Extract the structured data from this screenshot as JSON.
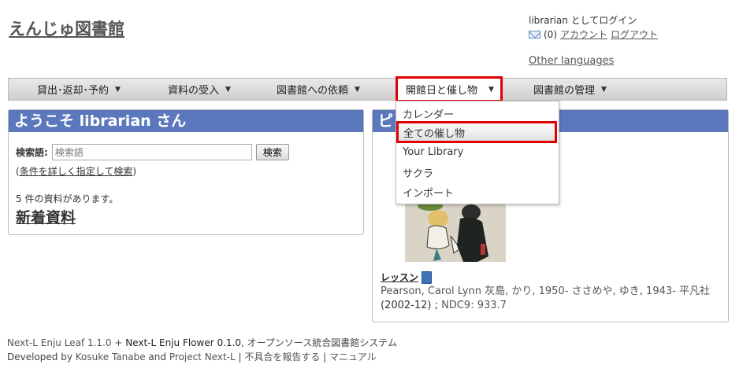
{
  "header": {
    "site_title": "えんじゅ図書館",
    "login_text": "librarian としてログイン",
    "mail_count": "(0)",
    "account_link": "アカウント",
    "logout_link": "ログアウト",
    "other_languages": "Other languages"
  },
  "nav": {
    "items": [
      {
        "label": "貸出･返却･予約"
      },
      {
        "label": "資料の受入"
      },
      {
        "label": "図書館への依頼"
      },
      {
        "label": "開館日と催し物"
      },
      {
        "label": "図書館の管理"
      }
    ],
    "caret": "▼"
  },
  "dropdown": {
    "items": [
      "カレンダー",
      "全ての催し物",
      "Your Library",
      "サクラ",
      "インポート"
    ],
    "selected": "全ての催し物"
  },
  "welcome": {
    "title": "ようこそ librarian さん",
    "search_label": "検索語:",
    "search_placeholder": "検索語",
    "search_button": "検索",
    "advanced_paren_open": "(",
    "advanced_link": "条件を詳しく指定して検索",
    "advanced_paren_close": ")",
    "count_text": "5 件の資料があります。",
    "new_items_link": "新着資料"
  },
  "pickup": {
    "title": "ピ",
    "book_title": "レッスン",
    "author1": "Pearson, Carol Lynn",
    "author2": "灰島, かり, 1950-",
    "author3": "ささめや, ゆき, 1943-",
    "publisher": "平凡社",
    "date": "(2002-12) ;",
    "ndc": "NDC9: 933.7"
  },
  "footer": {
    "leaf": "Next-L Enju Leaf 1.1.0",
    "plus": " + ",
    "flower": "Next-L Enju Flower 0.1.0",
    "tagline": ", オープンソース統合図書館システム",
    "developed_by": "Developed by ",
    "kosuke": "Kosuke Tanabe",
    "and": " and ",
    "project": "Project Next-L",
    "sep": " | ",
    "report": "不具合を報告する",
    "manual": "マニュアル"
  },
  "colors": {
    "panel_header": "#5b78bd",
    "highlight": "#e00000"
  }
}
